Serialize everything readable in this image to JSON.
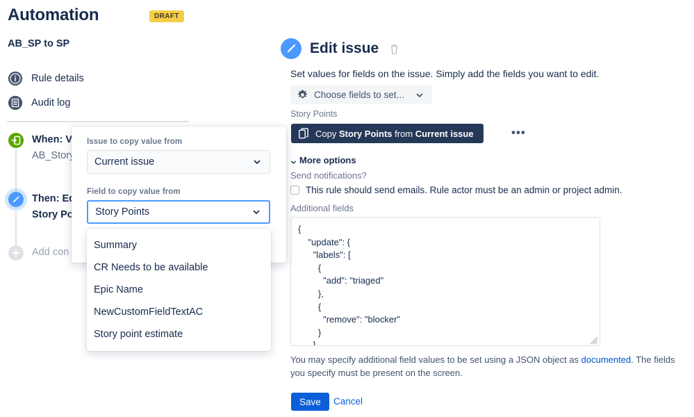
{
  "header": {
    "title": "Automation",
    "status_badge": "DRAFT",
    "rule_name": "AB_SP to SP"
  },
  "sidebar": {
    "items": [
      {
        "label": "Rule details",
        "icon": "info-circle-icon"
      },
      {
        "label": "Audit log",
        "icon": "document-circle-icon"
      }
    ]
  },
  "rule_tree": {
    "trigger": {
      "title": "When: Va",
      "subtitle": "AB_Story F",
      "icon": "trigger-icon",
      "icon_color": "#5AA700"
    },
    "action": {
      "title": "Then: Ed",
      "subtitle": "Story Poin",
      "icon": "edit-pencil-icon",
      "icon_color": "#4C9AFF"
    },
    "add": {
      "label": "Add con",
      "icon": "plus-circle-icon"
    }
  },
  "popover": {
    "issue_label": "Issue to copy value from",
    "issue_value": "Current issue",
    "field_label": "Field to copy value from",
    "field_value": "Story Points",
    "options": [
      "Summary",
      "CR Needs to be available",
      "Epic Name",
      "NewCustomFieldTextAC",
      "Story point estimate"
    ]
  },
  "panel": {
    "title": "Edit issue",
    "avatar_icon": "edit-pencil-avatar-icon",
    "delete_icon": "trash-icon",
    "description": "Set values for fields on the issue. Simply add the fields you want to edit.",
    "choose_fields_label": "Choose fields to set...",
    "choose_fields_icon": "gear-icon",
    "field_group_label": "Story Points",
    "copy_chip": {
      "prefix": "Copy ",
      "field": "Story Points",
      "middle": " from ",
      "source": "Current issue",
      "icon": "copy-icon"
    },
    "chip_more_label": "•••",
    "more_options_label": "More options",
    "send_notifications_label": "Send notifications?",
    "notifications_checkbox_label": "This rule should send emails. Rule actor must be an admin or project admin.",
    "notifications_checked": false,
    "additional_fields_label": "Additional fields",
    "additional_fields_value": "{\n    \"update\": {\n      \"labels\": [\n        {\n          \"add\": \"triaged\"\n        },\n        {\n          \"remove\": \"blocker\"\n        }\n      ],",
    "help_prefix": "You may specify additional field values to be set using a JSON object as ",
    "help_link": "documented",
    "help_suffix": ". The fields you specify must be present on the screen.",
    "save_label": "Save",
    "cancel_label": "Cancel"
  },
  "colors": {
    "accent_blue": "#0C5FD8",
    "link_blue": "#0052CC",
    "chip_navy": "#253858",
    "badge_yellow": "#F5CD47",
    "trigger_green": "#5AA700",
    "focus_blue": "#4C9AFF"
  }
}
